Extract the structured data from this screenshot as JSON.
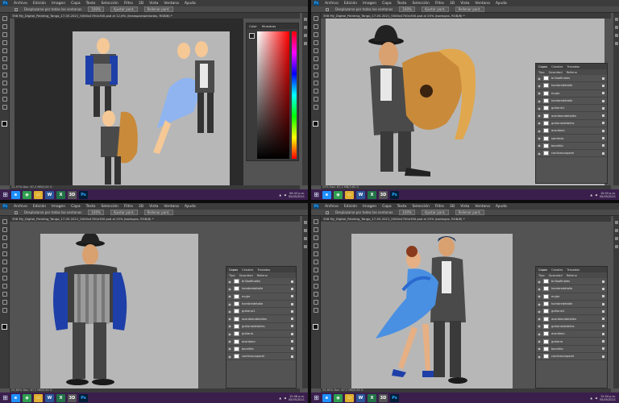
{
  "app": {
    "logo": "Ps",
    "menu": [
      "Archivo",
      "Edición",
      "Imagen",
      "Capa",
      "Texto",
      "Selección",
      "Filtro",
      "3D",
      "Vista",
      "Ventana",
      "Ayuda"
    ],
    "options": {
      "scroll_all": "Desplazarse por todas las ventanas",
      "zoom": "100%",
      "fit_screen": "Ajustar pant.",
      "fill_screen": "Rellenar pant."
    }
  },
  "quadrants": [
    {
      "doc_tab": "358 My_Digital_Painting_Tango_17-05-2021_5000x4700x300.psd al 12,6% (lineasparapintadas, RGB/8) *",
      "status": "12,57%     Doc: 67,2 MB/3,62 G",
      "panel": {
        "tabs": [
          "Color",
          "Muestras"
        ]
      },
      "clock": {
        "time": "09:43 p.m.",
        "date": "05/05/2021"
      }
    },
    {
      "doc_tab": "358 My_Digital_Painting_Tango_17-05-2021_5000x4700x300.psd al 25% (borbujas, RGB/8) *",
      "status": "25%     Doc: 67,2 MB/3,62 G",
      "panel": {
        "tabs": [
          "Capas",
          "Canales",
          "Trazados"
        ],
        "filter": "Tipo",
        "opacity_label": "Opacidad",
        "fill_label": "Relleno"
      },
      "layers": [
        "brilloafinales",
        "hombredetalle",
        "mujer",
        "hombredetalle",
        "guitarra1",
        "acordeondetalles",
        "guitarradetalles",
        "acordeon",
        "sombras",
        "bocetito",
        "contiraconparel"
      ],
      "clock": {
        "time": "10:03 p.m.",
        "date": "05/05/2021"
      }
    },
    {
      "doc_tab": "358 My_Digital_Painting_Tango_17-05-2021_5000x4700x300.psd al 25% (borbujas, RGB/8) *",
      "status": "25,65%     Doc: 67,2 MB/3,62 G",
      "panel": {
        "tabs": [
          "Capas",
          "Canales",
          "Trazados"
        ],
        "filter": "Tipo",
        "opacity_label": "Opacidad",
        "fill_label": "Relleno"
      },
      "layers": [
        "brilloafinales",
        "hombredetalle",
        "mujer",
        "hombredetalle",
        "guitarra1",
        "acordeondetalles",
        "guitarradetalles",
        "guitarra",
        "acordeon",
        "bocetito",
        "contiraconparel"
      ],
      "clock": {
        "time": "12:06 p.m.",
        "date": "05/05/2021"
      }
    },
    {
      "doc_tab": "358 My_Digital_Painting_Tango_17-05-2021_5000x4700x300.psd al 25% (borbujas, RGB/8) *",
      "status": "25,65%     Doc: 67,2 MB/3,62 G",
      "panel": {
        "tabs": [
          "Capas",
          "Canales",
          "Trazados"
        ],
        "filter": "Tipo",
        "opacity_label": "Opacidad",
        "fill_label": "Relleno"
      },
      "layers": [
        "brilloafinales",
        "hombredetalle",
        "mujer",
        "hombredetalle",
        "guitarra1",
        "acordeondetalles",
        "guitarradetalles",
        "acordeon",
        "guitarra",
        "bocetito",
        "contiraconparel"
      ],
      "clock": {
        "time": "12:04 p.m.",
        "date": "05/05/2021"
      }
    }
  ],
  "taskbar_apps": [
    {
      "name": "edge",
      "glyph": "e",
      "color": "#1e90ff"
    },
    {
      "name": "chrome",
      "glyph": "◉",
      "color": "#2e9e4f"
    },
    {
      "name": "explorer",
      "glyph": "▭",
      "color": "#e0b030"
    },
    {
      "name": "word",
      "glyph": "W",
      "color": "#2b579a"
    },
    {
      "name": "excel",
      "glyph": "X",
      "color": "#217346"
    },
    {
      "name": "3d-paint",
      "glyph": "3D",
      "color": "#555"
    },
    {
      "name": "photoshop",
      "glyph": "Ps",
      "color": "#001e36"
    }
  ],
  "colors": {
    "canvas_bg": "#b7b7b7",
    "ps_ui": "#535353",
    "taskbar": "#3a1f4d",
    "dress": "#4a90e2",
    "suit": "#4a4a4a",
    "guitar": "#c98a3a",
    "accordion_blue": "#1e3fa8"
  }
}
